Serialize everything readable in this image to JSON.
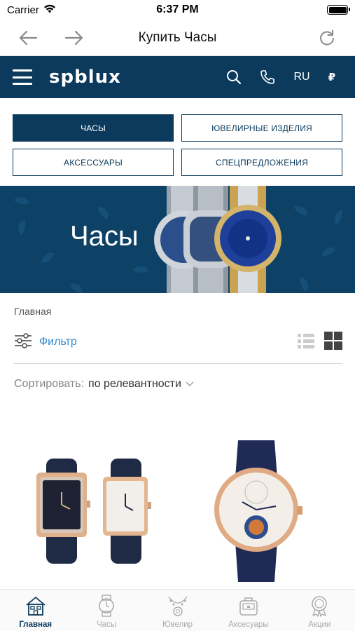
{
  "status_bar": {
    "carrier": "Carrier",
    "time": "6:37 PM",
    "battery_level": 1.0
  },
  "browser": {
    "title": "Купить Часы",
    "back_icon": "arrow-left-icon",
    "forward_icon": "arrow-right-icon",
    "reload_icon": "reload-icon"
  },
  "header": {
    "logo": "spblux",
    "language": "RU",
    "currency": "₽",
    "background": "#0b3a5c"
  },
  "categories": [
    {
      "label": "ЧАСЫ",
      "active": true
    },
    {
      "label": "ЮВЕЛИРНЫЕ ИЗДЕЛИЯ",
      "active": false
    },
    {
      "label": "АКСЕССУАРЫ",
      "active": false
    },
    {
      "label": "СПЕЦПРЕДЛОЖЕНИЯ",
      "active": false
    }
  ],
  "banner": {
    "title": "Часы"
  },
  "breadcrumb": "Главная",
  "filter": {
    "label": "Фильтр"
  },
  "sort": {
    "label": "Сортировать:",
    "value": "по релевантности"
  },
  "tabs": [
    {
      "label": "Главная",
      "icon": "home-icon",
      "active": true
    },
    {
      "label": "Часы",
      "icon": "watch-icon",
      "active": false
    },
    {
      "label": "Ювелир",
      "icon": "jewelry-icon",
      "active": false
    },
    {
      "label": "Аксесуары",
      "icon": "bag-icon",
      "active": false
    },
    {
      "label": "Акции",
      "icon": "badge-icon",
      "active": false
    }
  ],
  "colors": {
    "primary": "#0b3a5c",
    "link": "#2f8ad1"
  }
}
